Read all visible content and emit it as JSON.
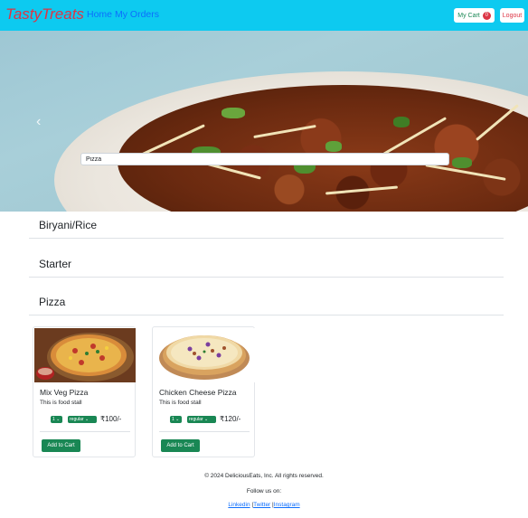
{
  "navbar": {
    "brand": "TastyTreats",
    "links": [
      "Home",
      "My Orders"
    ],
    "cart_label": "My Cart",
    "cart_count": "0",
    "logout_label": "Logout"
  },
  "hero": {
    "prev_arrow": "‹",
    "search_value": "Pizza"
  },
  "categories": [
    "Biryani/Rice",
    "Starter",
    "Pizza"
  ],
  "products": [
    {
      "name": "Mix Veg Pizza",
      "description": "This is food stall",
      "quantity": "1",
      "size": "regular",
      "price": "₹100/-",
      "add_label": "Add to Cart"
    },
    {
      "name": "Chicken Cheese Pizza",
      "description": "This is food stall",
      "quantity": "1",
      "size": "regular",
      "price": "₹120/-",
      "add_label": "Add to Cart"
    }
  ],
  "footer": {
    "copyright": "© 2024 DeliciousEats, Inc. All rights reserved.",
    "follow": "Follow us on:",
    "links": [
      "Linkedin",
      "Twitter",
      "Instagram"
    ]
  },
  "colors": {
    "navbar": "#0dcaf0",
    "brand": "#dc3545",
    "success": "#198754",
    "link": "#0d6efd"
  }
}
